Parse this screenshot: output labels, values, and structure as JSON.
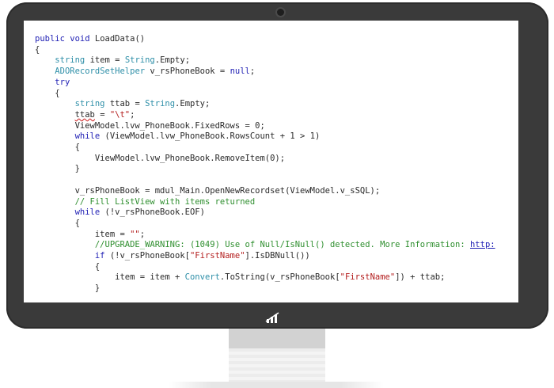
{
  "colors": {
    "keyword": "#1f1fb4",
    "type": "#2e8fa8",
    "string": "#b31d1d",
    "comment": "#2f8f2f",
    "plain": "#2a2a2a",
    "monitor_bezel": "#3a3a3a"
  },
  "icons": {
    "brand": "brand-logo-icon",
    "camera": "camera-dot-icon"
  },
  "code": {
    "lines": [
      [
        [
          "kw",
          "public "
        ],
        [
          "kw",
          "void "
        ],
        [
          "p",
          "LoadData()"
        ]
      ],
      [
        [
          "p",
          "{"
        ]
      ],
      [
        [
          "p",
          "    "
        ],
        [
          "ty",
          "string "
        ],
        [
          "p",
          "item = "
        ],
        [
          "ty",
          "String"
        ],
        [
          "p",
          ".Empty;"
        ]
      ],
      [
        [
          "p",
          "    "
        ],
        [
          "ty",
          "ADORecordSetHelper "
        ],
        [
          "p",
          "v_rsPhoneBook = "
        ],
        [
          "kw",
          "null"
        ],
        [
          "p",
          ";"
        ]
      ],
      [
        [
          "p",
          "    "
        ],
        [
          "kw",
          "try"
        ]
      ],
      [
        [
          "p",
          "    {"
        ]
      ],
      [
        [
          "p",
          "        "
        ],
        [
          "ty",
          "string "
        ],
        [
          "p",
          "ttab = "
        ],
        [
          "ty",
          "String"
        ],
        [
          "p",
          ".Empty;"
        ]
      ],
      [
        [
          "p",
          "        "
        ],
        [
          "sq",
          "ttab"
        ],
        [
          "p",
          " = "
        ],
        [
          "st",
          "\"\\t\""
        ],
        [
          "p",
          ";"
        ]
      ],
      [
        [
          "p",
          "        ViewModel.lvw_PhoneBook.FixedRows = 0;"
        ]
      ],
      [
        [
          "p",
          "        "
        ],
        [
          "kw",
          "while "
        ],
        [
          "p",
          "(ViewModel.lvw_PhoneBook.RowsCount + 1 > 1)"
        ]
      ],
      [
        [
          "p",
          "        {"
        ]
      ],
      [
        [
          "p",
          "            ViewModel.lvw_PhoneBook.RemoveItem(0);"
        ]
      ],
      [
        [
          "p",
          "        }"
        ]
      ],
      [],
      [
        [
          "p",
          "        v_rsPhoneBook = mdul_Main.OpenNewRecordset(ViewModel.v_sSQL);"
        ]
      ],
      [
        [
          "p",
          "        "
        ],
        [
          "cm",
          "// Fill ListView with items returned"
        ]
      ],
      [
        [
          "p",
          "        "
        ],
        [
          "kw",
          "while "
        ],
        [
          "p",
          "(!v_rsPhoneBook.EOF)"
        ]
      ],
      [
        [
          "p",
          "        {"
        ]
      ],
      [
        [
          "p",
          "            item = "
        ],
        [
          "st",
          "\"\""
        ],
        [
          "p",
          ";"
        ]
      ],
      [
        [
          "p",
          "            "
        ],
        [
          "cm",
          "//UPGRADE_WARNING: (1049) Use of Null/IsNull() detected. More Information: "
        ],
        [
          "lk",
          "http:"
        ]
      ],
      [
        [
          "p",
          "            "
        ],
        [
          "kw",
          "if "
        ],
        [
          "p",
          "(!v_rsPhoneBook["
        ],
        [
          "st",
          "\"FirstName\""
        ],
        [
          "p",
          "].IsDBNull())"
        ]
      ],
      [
        [
          "p",
          "            {"
        ]
      ],
      [
        [
          "p",
          "                item = item + "
        ],
        [
          "ty",
          "Convert"
        ],
        [
          "p",
          ".ToString(v_rsPhoneBook["
        ],
        [
          "st",
          "\"FirstName\""
        ],
        [
          "p",
          "]) + ttab;"
        ]
      ],
      [
        [
          "p",
          "            }"
        ]
      ]
    ]
  }
}
